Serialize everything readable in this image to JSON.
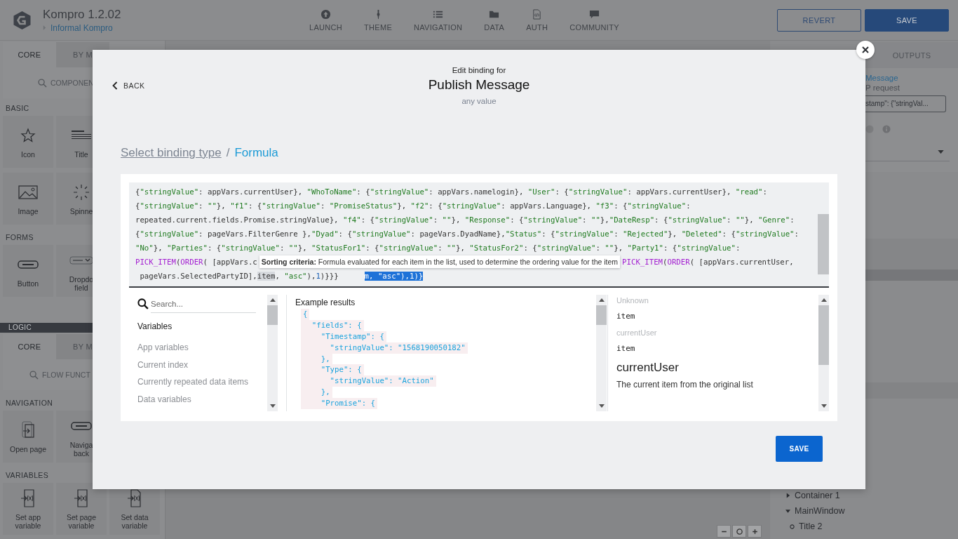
{
  "app": {
    "title": "Kompro 1.2.02",
    "subtitle": "Informal Kompro"
  },
  "nav": [
    {
      "label": "LAUNCH",
      "kind": "launch"
    },
    {
      "label": "THEME",
      "kind": "theme"
    },
    {
      "label": "NAVIGATION",
      "kind": "navigation"
    },
    {
      "label": "DATA",
      "kind": "data"
    },
    {
      "label": "AUTH",
      "kind": "auth"
    },
    {
      "label": "COMMUNITY",
      "kind": "community"
    }
  ],
  "header_buttons": [
    {
      "label": "REVERT",
      "kind": "outline"
    },
    {
      "label": "SAVE",
      "kind": "primary"
    }
  ],
  "sidebar": {
    "tabs": [
      {
        "label": "CORE",
        "selected": true
      },
      {
        "label": "BY M",
        "selected": false
      }
    ],
    "search_placeholder": "COMPONEN",
    "sections": [
      {
        "title": "BASIC",
        "tiles": [
          {
            "label": "Icon",
            "kind": "star"
          },
          {
            "label": "Title",
            "kind": "title"
          },
          {
            "label": "Image",
            "kind": "image"
          },
          {
            "label": "Spinne",
            "kind": "spinner"
          }
        ]
      },
      {
        "title": "FORMS",
        "tiles": [
          {
            "label": "Button",
            "kind": "button"
          },
          {
            "label": "Dropdo field",
            "kind": "dropdown"
          }
        ]
      }
    ]
  },
  "logic": {
    "title": "LOGIC",
    "tabs": [
      {
        "label": "CORE",
        "selected": true
      },
      {
        "label": "BY M",
        "selected": false
      }
    ],
    "search_placeholder": "FLOW FUNCT",
    "sections": [
      {
        "title": "NAVIGATION",
        "tiles": [
          {
            "label": "Open page",
            "kind": "open"
          },
          {
            "label": "Naviga back",
            "kind": "button"
          }
        ]
      },
      {
        "title": "VARIABLES",
        "tiles": [
          {
            "label": "Set app variable",
            "kind": "setapp"
          },
          {
            "label": "Set page variable",
            "kind": "setpage"
          },
          {
            "label": "Set data variable",
            "kind": "setdata"
          }
        ]
      }
    ]
  },
  "right_panel": {
    "tabs": [
      {
        "label": "OUTPUTS",
        "selected": false
      }
    ],
    "title": "Message",
    "subtitle": "P request",
    "field_value": "stamp\": {\"stringVal...",
    "tree": [
      {
        "label": "Container 1",
        "expanded": false
      },
      {
        "label": "MainWindow",
        "expanded": true,
        "children": [
          {
            "label": "Title 2"
          }
        ]
      }
    ]
  },
  "modal": {
    "back": "BACK",
    "kicker": "Edit binding for",
    "title": "Publish Message",
    "subtitle": "any value",
    "breadcrumb": [
      {
        "label": "Select binding type",
        "kind": "link"
      },
      {
        "label": "/",
        "kind": "separator"
      },
      {
        "label": "Formula",
        "kind": "current"
      }
    ],
    "code_lines": [
      [
        {
          "kind": "code",
          "text": "{\"stringValue\": appVars.currentUser}, \"WhoToName\": {\"stringValue\": appVars.namelogin}, \"User\": {\"stringValue\": appVars.currentUser}, \"read\":"
        }
      ],
      [
        {
          "kind": "code",
          "text": "{\"stringValue\": \"\"}, \"f1\": {\"stringValue\": \"PromiseStatus\"}, \"f2\": {\"stringValue\": appVars.Language}, \"f3\": {\"stringValue\":"
        }
      ],
      [
        {
          "kind": "code",
          "text": "repeated.current.fields.Promise.stringValue}, \"f4\": {\"stringValue\": \"\"}, \"Response\": {\"stringValue\": \"\"},\"DateResp\": {\"stringValue\": \"\"}, \"Genre\":"
        }
      ],
      [
        {
          "kind": "code",
          "text": "{\"stringValue\": pageVars.FilterGenre },\"Dyad\": {\"stringValue\": pageVars.DyadName},\"Status\": {\"stringValue\": \"Rejected\"}, \"Deleted\": {\"stringValue\":"
        }
      ],
      [
        {
          "kind": "code",
          "text": "\"No\"}, \"Parties\": {\"stringValue\": \"\"}, \"StatusFor1\": {\"stringValue\": \"\"}, \"StatusFor2\": {\"stringValue\": \"\"}, \"Party1\": {\"stringValue\":"
        }
      ],
      [
        {
          "kind": "code",
          "text": "PICK_ITEM(ORDER( [appVars.c"
        },
        {
          "kind": "tooltip",
          "text": "**Sorting criteria:** Formula evaluated for each item in the list, used to determine the ordering value for the item"
        },
        {
          "kind": "code",
          "text": "PICK_ITEM(ORDER( [appVars.currentUser,"
        }
      ],
      [
        {
          "kind": "code",
          "text": " pageVars.SelectedPartyID],"
        },
        {
          "kind": "match",
          "text": "item"
        },
        {
          "kind": "code",
          "text": ", \"asc\"),1)}}}"
        },
        {
          "kind": "selection",
          "text": "m, \"asc\"),1)}"
        }
      ]
    ],
    "variables": {
      "placeholder": "Search...",
      "heading": "Variables",
      "items": [
        "App variables",
        "Current index",
        "Currently repeated data items",
        "Data variables"
      ]
    },
    "example": {
      "heading": "Example results",
      "lines": [
        "{",
        "  \"fields\": {",
        "    \"Timestamp\": {",
        "      \"stringValue\": \"1568190050182\"",
        "    },",
        "    \"Type\": {",
        "      \"stringValue\": \"Action\"",
        "    },",
        "    \"Promise\": {"
      ]
    },
    "info": [
      {
        "text": "Unknown",
        "kind": "muted"
      },
      {
        "text": "item",
        "kind": "code"
      },
      {
        "text": "currentUser",
        "kind": "muted"
      },
      {
        "text": "item",
        "kind": "code"
      },
      {
        "text": "currentUser",
        "kind": "title"
      },
      {
        "text": "The current item from the original list",
        "kind": "body"
      }
    ],
    "save": "SAVE"
  }
}
